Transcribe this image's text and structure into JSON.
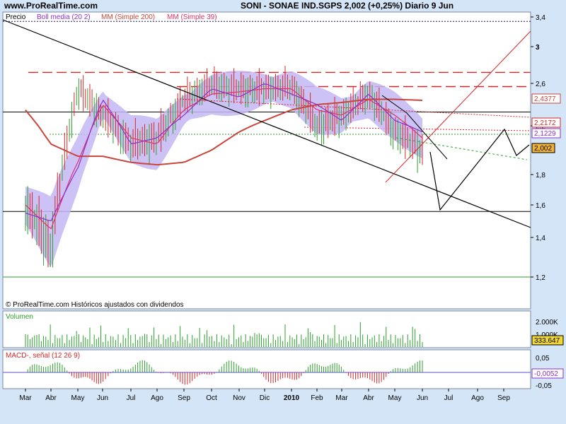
{
  "site": "www.ProRealTime.com",
  "header": {
    "symbol": "SONI - SONAE IND.SGPS",
    "last": "2,002 (+0,25%)",
    "period": "Diario 9 Jun"
  },
  "colors": {
    "background": "#d4e5f7",
    "panel": "#ffffff",
    "candle_up": "#2ca02c",
    "candle_down": "#d62728",
    "bollinger": "#c4b7f5",
    "ma200": "#c8463c",
    "ma39": "#e0316e",
    "boll_mid": "#8b2fc9",
    "volume": "#2ca02c",
    "macd_pos": "#2ca02c",
    "macd_neg": "#d62728"
  },
  "price_panel": {
    "legend": {
      "price": "Precio",
      "boll": "Boll media (20 2)",
      "mm200": "MM (Simple 200)",
      "mm39": "MM (Simple 39)"
    },
    "yaxis_ticks": [
      "3,4",
      "3",
      "2,6",
      "2,2",
      "1,8",
      "1,6",
      "1,4",
      "1,2"
    ],
    "footer": "© ProRealTime.com Históricos ajustados con dividendos",
    "badges": {
      "a": "2,4377",
      "b": "2,2172",
      "c": "2,1229",
      "last": "2,002"
    }
  },
  "volume_panel": {
    "label": "Volumen",
    "ticks": [
      "2.000K",
      "1.000K"
    ],
    "badge": "333.647"
  },
  "macd_panel": {
    "label": "MACD-, señal (12 26 9)",
    "ticks": [
      "0,05",
      "-0,05"
    ],
    "badge": "-0,0052"
  },
  "xaxis": [
    "Mar",
    "Abr",
    "May",
    "Jun",
    "Jul",
    "Ago",
    "Sep",
    "Oct",
    "Nov",
    "Dic",
    "2010",
    "Feb",
    "Mar",
    "Abr",
    "May",
    "Jun",
    "Jul",
    "Ago",
    "Sep"
  ],
  "chart_data": {
    "type": "line",
    "title": "SONI - SONAE IND.SGPS",
    "ylim": [
      1.1,
      3.4
    ],
    "x": [
      "Mar",
      "Abr",
      "May",
      "Jun",
      "Jul",
      "Ago",
      "Sep",
      "Oct",
      "Nov",
      "Dic",
      "2010",
      "Feb",
      "Mar",
      "Abr",
      "May",
      "Jun"
    ],
    "series": [
      {
        "name": "Precio",
        "values": [
          1.6,
          1.35,
          2.55,
          2.3,
          2.05,
          2.1,
          2.45,
          2.6,
          2.55,
          2.55,
          2.58,
          2.2,
          2.3,
          2.5,
          2.15,
          2.0
        ]
      },
      {
        "name": "MM (Simple 200)",
        "values": [
          2.35,
          2.05,
          1.95,
          1.95,
          1.9,
          1.88,
          1.9,
          2.0,
          2.15,
          2.25,
          2.35,
          2.4,
          2.42,
          2.45,
          2.45,
          2.44
        ]
      },
      {
        "name": "MM (Simple 39)",
        "values": [
          1.6,
          1.45,
          1.9,
          2.4,
          2.1,
          2.05,
          2.35,
          2.5,
          2.52,
          2.55,
          2.55,
          2.35,
          2.3,
          2.45,
          2.3,
          2.1
        ]
      }
    ],
    "levels": [
      3.34,
      2.72,
      2.57,
      2.33,
      1.56,
      1.2
    ],
    "volume_ylim": [
      0,
      2500
    ],
    "macd_ylim": [
      -0.06,
      0.06
    ]
  }
}
